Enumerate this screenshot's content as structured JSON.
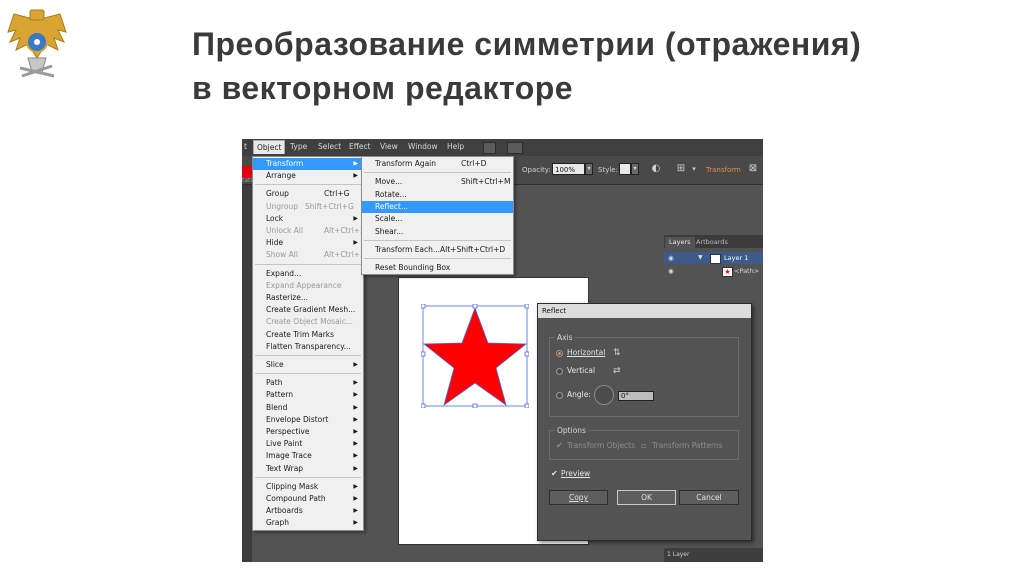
{
  "slide": {
    "title_line1": "Преобразование симметрии (отражения)",
    "title_line2": "в векторном редакторе"
  },
  "menubar": {
    "items": [
      "t",
      "Object",
      "Type",
      "Select",
      "Effect",
      "View",
      "Window",
      "Help"
    ]
  },
  "control_bar": {
    "opacity_label": "Opacity:",
    "opacity_value": "100%",
    "style_label": "Style:",
    "transform_link": "Transform",
    "left_cut_text": "tati"
  },
  "object_menu": {
    "items": [
      {
        "label": "Transform",
        "shortcut": "",
        "submenu": true,
        "disabled": false,
        "highlight": true
      },
      {
        "label": "Arrange",
        "shortcut": "",
        "submenu": true,
        "disabled": false
      },
      {
        "label": "Group",
        "shortcut": "Ctrl+G",
        "submenu": false,
        "disabled": false
      },
      {
        "label": "Ungroup",
        "shortcut": "Shift+Ctrl+G",
        "submenu": false,
        "disabled": true
      },
      {
        "label": "Lock",
        "shortcut": "",
        "submenu": true,
        "disabled": false
      },
      {
        "label": "Unlock All",
        "shortcut": "Alt+Ctrl+2",
        "submenu": false,
        "disabled": true
      },
      {
        "label": "Hide",
        "shortcut": "",
        "submenu": true,
        "disabled": false
      },
      {
        "label": "Show All",
        "shortcut": "Alt+Ctrl+3",
        "submenu": false,
        "disabled": true
      },
      {
        "label": "Expand...",
        "shortcut": "",
        "submenu": false,
        "disabled": false
      },
      {
        "label": "Expand Appearance",
        "shortcut": "",
        "submenu": false,
        "disabled": true
      },
      {
        "label": "Rasterize...",
        "shortcut": "",
        "submenu": false,
        "disabled": false
      },
      {
        "label": "Create Gradient Mesh...",
        "shortcut": "",
        "submenu": false,
        "disabled": false
      },
      {
        "label": "Create Object Mosaic...",
        "shortcut": "",
        "submenu": false,
        "disabled": true
      },
      {
        "label": "Create Trim Marks",
        "shortcut": "",
        "submenu": false,
        "disabled": false
      },
      {
        "label": "Flatten Transparency...",
        "shortcut": "",
        "submenu": false,
        "disabled": false
      },
      {
        "label": "Slice",
        "shortcut": "",
        "submenu": true,
        "disabled": false
      },
      {
        "label": "Path",
        "shortcut": "",
        "submenu": true,
        "disabled": false
      },
      {
        "label": "Pattern",
        "shortcut": "",
        "submenu": true,
        "disabled": false
      },
      {
        "label": "Blend",
        "shortcut": "",
        "submenu": true,
        "disabled": false
      },
      {
        "label": "Envelope Distort",
        "shortcut": "",
        "submenu": true,
        "disabled": false
      },
      {
        "label": "Perspective",
        "shortcut": "",
        "submenu": true,
        "disabled": false
      },
      {
        "label": "Live Paint",
        "shortcut": "",
        "submenu": true,
        "disabled": false
      },
      {
        "label": "Image Trace",
        "shortcut": "",
        "submenu": true,
        "disabled": false
      },
      {
        "label": "Text Wrap",
        "shortcut": "",
        "submenu": true,
        "disabled": false
      },
      {
        "label": "Clipping Mask",
        "shortcut": "",
        "submenu": true,
        "disabled": false
      },
      {
        "label": "Compound Path",
        "shortcut": "",
        "submenu": true,
        "disabled": false
      },
      {
        "label": "Artboards",
        "shortcut": "",
        "submenu": true,
        "disabled": false
      },
      {
        "label": "Graph",
        "shortcut": "",
        "submenu": true,
        "disabled": false
      }
    ]
  },
  "transform_submenu": {
    "items": [
      {
        "label": "Transform Again",
        "shortcut": "Ctrl+D",
        "highlight": false
      },
      {
        "label": "Move...",
        "shortcut": "Shift+Ctrl+M",
        "highlight": false
      },
      {
        "label": "Rotate...",
        "shortcut": "",
        "highlight": false
      },
      {
        "label": "Reflect...",
        "shortcut": "",
        "highlight": true
      },
      {
        "label": "Scale...",
        "shortcut": "",
        "highlight": false
      },
      {
        "label": "Shear...",
        "shortcut": "",
        "highlight": false
      },
      {
        "label": "Transform Each...",
        "shortcut": "Alt+Shift+Ctrl+D",
        "highlight": false
      },
      {
        "label": "Reset Bounding Box",
        "shortcut": "",
        "highlight": false
      }
    ]
  },
  "layers_panel": {
    "tabs": [
      "Layers",
      "Artboards"
    ],
    "layer_name": "Layer 1",
    "path_name": "<Path>",
    "footer": "1 Layer"
  },
  "reflect_dialog": {
    "title": "Reflect",
    "axis_label": "Axis",
    "horizontal": "Horizontal",
    "vertical": "Vertical",
    "angle_label": "Angle:",
    "angle_value": "0°",
    "options_label": "Options",
    "transform_objects": "Transform Objects",
    "transform_patterns": "Transform Patterns",
    "preview": "Preview",
    "copy": "Copy",
    "ok": "OK",
    "cancel": "Cancel",
    "selected_axis": "horizontal",
    "preview_checked": true
  },
  "colors": {
    "star_fill": "#ff0000",
    "selection": "#4a6cd8",
    "menu_highlight": "#3399ff",
    "accent_orange": "#e98a45"
  }
}
